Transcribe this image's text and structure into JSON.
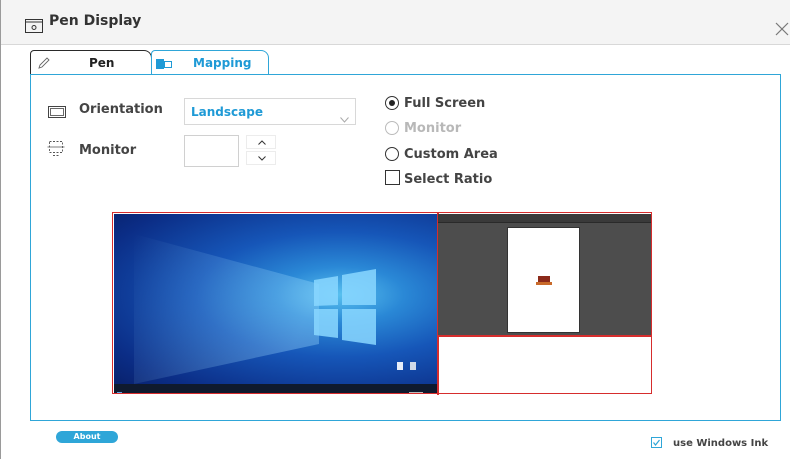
{
  "window": {
    "title": "Pen Display"
  },
  "tabs": [
    {
      "label": "Pen",
      "active": false
    },
    {
      "label": "Mapping",
      "active": true
    }
  ],
  "mapping": {
    "orientation_label": "Orientation",
    "orientation_value": "Landscape",
    "monitor_label": "Monitor",
    "monitor_value": "",
    "options": [
      {
        "label": "Full Screen",
        "checked": true,
        "disabled": false
      },
      {
        "label": "Monitor",
        "checked": false,
        "disabled": true
      },
      {
        "label": "Custom Area",
        "checked": false,
        "disabled": false
      }
    ],
    "select_ratio_label": "Select Ratio",
    "select_ratio_checked": false
  },
  "footer": {
    "about_label": "About",
    "windows_ink_label": "use Windows Ink",
    "windows_ink_checked": true
  },
  "colors": {
    "accent": "#2fa6d8",
    "mapping_border": "#d62d2d",
    "disabled_text": "#b8b8b8"
  },
  "icons": {
    "title": "pen-display-icon",
    "pen_tab": "pen-icon",
    "mapping_tab": "mapping-icon",
    "orientation": "orientation-icon",
    "monitor": "monitor-icon",
    "close": "close-icon"
  }
}
